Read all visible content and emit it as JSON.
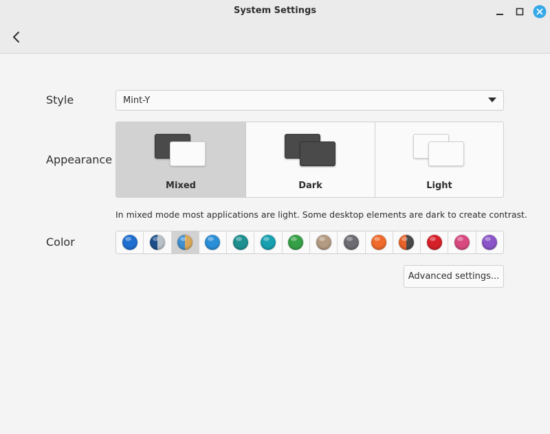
{
  "window": {
    "title": "System Settings"
  },
  "labels": {
    "style": "Style",
    "appearance": "Appearance",
    "color": "Color"
  },
  "style_dropdown": {
    "value": "Mint-Y"
  },
  "appearance": {
    "selected": "Mixed",
    "options": [
      {
        "label": "Mixed"
      },
      {
        "label": "Dark"
      },
      {
        "label": "Light"
      }
    ]
  },
  "description": "In mixed mode most applications are light. Some desktop elements are dark to create contrast.",
  "colors": {
    "selected_index": 2,
    "swatches": [
      {
        "left": "#1f6fd0",
        "right": "#1f6fd0"
      },
      {
        "left": "#1e4f8a",
        "right": "#b8c0c8"
      },
      {
        "left": "#3f8fd0",
        "right": "#d9a85a"
      },
      {
        "left": "#2b8fd8",
        "right": "#2b8fd8"
      },
      {
        "left": "#1f9090",
        "right": "#1f9090"
      },
      {
        "left": "#17a0b0",
        "right": "#17a0b0"
      },
      {
        "left": "#35a046",
        "right": "#35a046"
      },
      {
        "left": "#b39a82",
        "right": "#b39a82"
      },
      {
        "left": "#6c6c72",
        "right": "#6c6c72"
      },
      {
        "left": "#ef6a2c",
        "right": "#ef6a2c"
      },
      {
        "left": "#e8632a",
        "right": "#4a4a4a"
      },
      {
        "left": "#d6202a",
        "right": "#d6202a"
      },
      {
        "left": "#d84a80",
        "right": "#d84a80"
      },
      {
        "left": "#8a55c8",
        "right": "#8a55c8"
      }
    ]
  },
  "buttons": {
    "advanced": "Advanced settings..."
  },
  "icons": {
    "back": "back-arrow-icon",
    "minimize": "minimize-icon",
    "maximize": "maximize-icon",
    "close": "close-icon",
    "dropdown": "triangle-down-icon"
  }
}
